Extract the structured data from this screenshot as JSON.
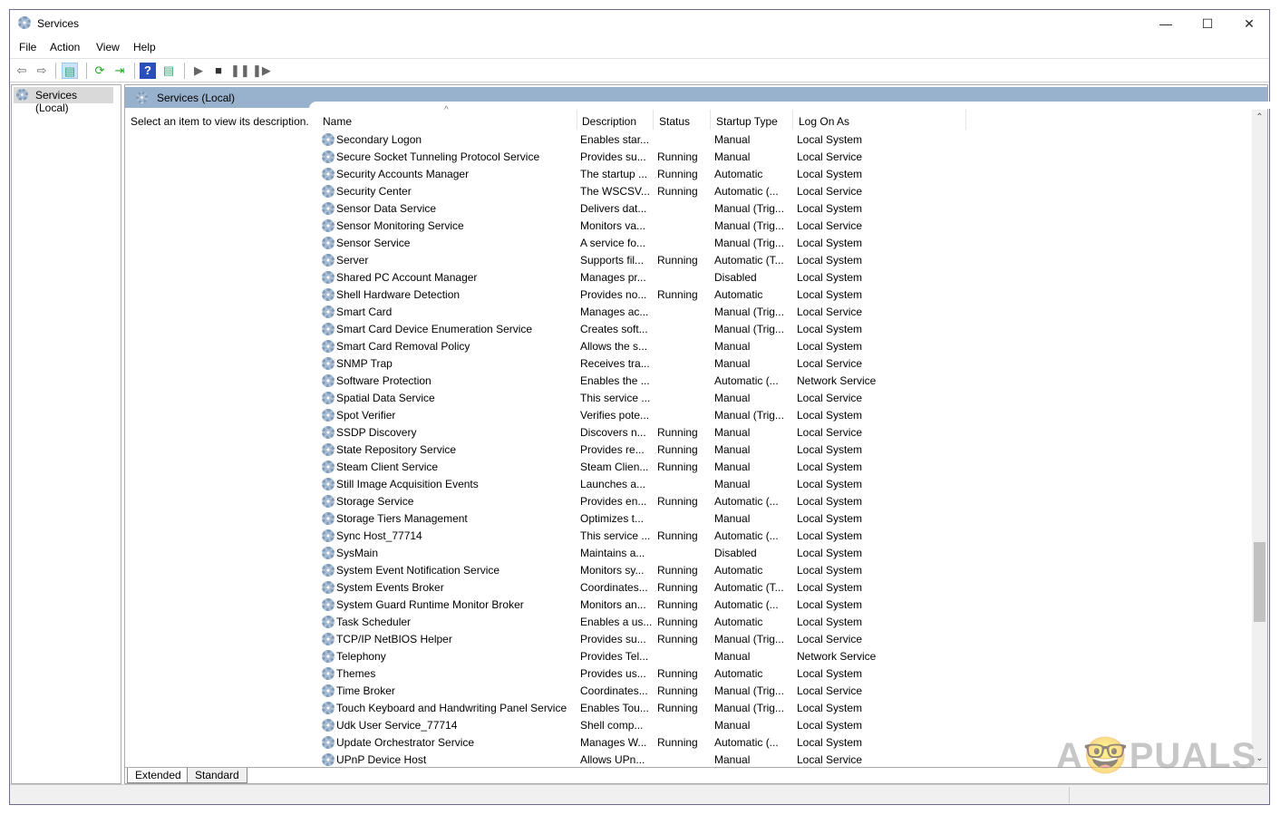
{
  "window": {
    "title": "Services",
    "minimize": "—",
    "maximize": "☐",
    "close": "✕"
  },
  "menu": [
    "File",
    "Action",
    "View",
    "Help"
  ],
  "tree": {
    "root": "Services (Local)"
  },
  "pane": {
    "title": "Services (Local)",
    "description_hint": "Select an item to view its description."
  },
  "columns": [
    "Name",
    "Description",
    "Status",
    "Startup Type",
    "Log On As"
  ],
  "rows": [
    [
      "Secondary Logon",
      "Enables star...",
      "",
      "Manual",
      "Local System"
    ],
    [
      "Secure Socket Tunneling Protocol Service",
      "Provides su...",
      "Running",
      "Manual",
      "Local Service"
    ],
    [
      "Security Accounts Manager",
      "The startup ...",
      "Running",
      "Automatic",
      "Local System"
    ],
    [
      "Security Center",
      "The WSCSV...",
      "Running",
      "Automatic (...",
      "Local Service"
    ],
    [
      "Sensor Data Service",
      "Delivers dat...",
      "",
      "Manual (Trig...",
      "Local System"
    ],
    [
      "Sensor Monitoring Service",
      "Monitors va...",
      "",
      "Manual (Trig...",
      "Local Service"
    ],
    [
      "Sensor Service",
      "A service fo...",
      "",
      "Manual (Trig...",
      "Local System"
    ],
    [
      "Server",
      "Supports fil...",
      "Running",
      "Automatic (T...",
      "Local System"
    ],
    [
      "Shared PC Account Manager",
      "Manages pr...",
      "",
      "Disabled",
      "Local System"
    ],
    [
      "Shell Hardware Detection",
      "Provides no...",
      "Running",
      "Automatic",
      "Local System"
    ],
    [
      "Smart Card",
      "Manages ac...",
      "",
      "Manual (Trig...",
      "Local Service"
    ],
    [
      "Smart Card Device Enumeration Service",
      "Creates soft...",
      "",
      "Manual (Trig...",
      "Local System"
    ],
    [
      "Smart Card Removal Policy",
      "Allows the s...",
      "",
      "Manual",
      "Local System"
    ],
    [
      "SNMP Trap",
      "Receives tra...",
      "",
      "Manual",
      "Local Service"
    ],
    [
      "Software Protection",
      "Enables the ...",
      "",
      "Automatic (...",
      "Network Service"
    ],
    [
      "Spatial Data Service",
      "This service ...",
      "",
      "Manual",
      "Local Service"
    ],
    [
      "Spot Verifier",
      "Verifies pote...",
      "",
      "Manual (Trig...",
      "Local System"
    ],
    [
      "SSDP Discovery",
      "Discovers n...",
      "Running",
      "Manual",
      "Local Service"
    ],
    [
      "State Repository Service",
      "Provides re...",
      "Running",
      "Manual",
      "Local System"
    ],
    [
      "Steam Client Service",
      "Steam Clien...",
      "Running",
      "Manual",
      "Local System"
    ],
    [
      "Still Image Acquisition Events",
      "Launches a...",
      "",
      "Manual",
      "Local System"
    ],
    [
      "Storage Service",
      "Provides en...",
      "Running",
      "Automatic (...",
      "Local System"
    ],
    [
      "Storage Tiers Management",
      "Optimizes t...",
      "",
      "Manual",
      "Local System"
    ],
    [
      "Sync Host_77714",
      "This service ...",
      "Running",
      "Automatic (...",
      "Local System"
    ],
    [
      "SysMain",
      "Maintains a...",
      "",
      "Disabled",
      "Local System"
    ],
    [
      "System Event Notification Service",
      "Monitors sy...",
      "Running",
      "Automatic",
      "Local System"
    ],
    [
      "System Events Broker",
      "Coordinates...",
      "Running",
      "Automatic (T...",
      "Local System"
    ],
    [
      "System Guard Runtime Monitor Broker",
      "Monitors an...",
      "Running",
      "Automatic (...",
      "Local System"
    ],
    [
      "Task Scheduler",
      "Enables a us...",
      "Running",
      "Automatic",
      "Local System"
    ],
    [
      "TCP/IP NetBIOS Helper",
      "Provides su...",
      "Running",
      "Manual (Trig...",
      "Local Service"
    ],
    [
      "Telephony",
      "Provides Tel...",
      "",
      "Manual",
      "Network Service"
    ],
    [
      "Themes",
      "Provides us...",
      "Running",
      "Automatic",
      "Local System"
    ],
    [
      "Time Broker",
      "Coordinates...",
      "Running",
      "Manual (Trig...",
      "Local Service"
    ],
    [
      "Touch Keyboard and Handwriting Panel Service",
      "Enables Tou...",
      "Running",
      "Manual (Trig...",
      "Local System"
    ],
    [
      "Udk User Service_77714",
      "Shell comp...",
      "",
      "Manual",
      "Local System"
    ],
    [
      "Update Orchestrator Service",
      "Manages W...",
      "Running",
      "Automatic (...",
      "Local System"
    ],
    [
      "UPnP Device Host",
      "Allows UPn...",
      "",
      "Manual",
      "Local Service"
    ]
  ],
  "tabs": [
    "Extended",
    "Standard"
  ],
  "watermark": "APPUALS"
}
